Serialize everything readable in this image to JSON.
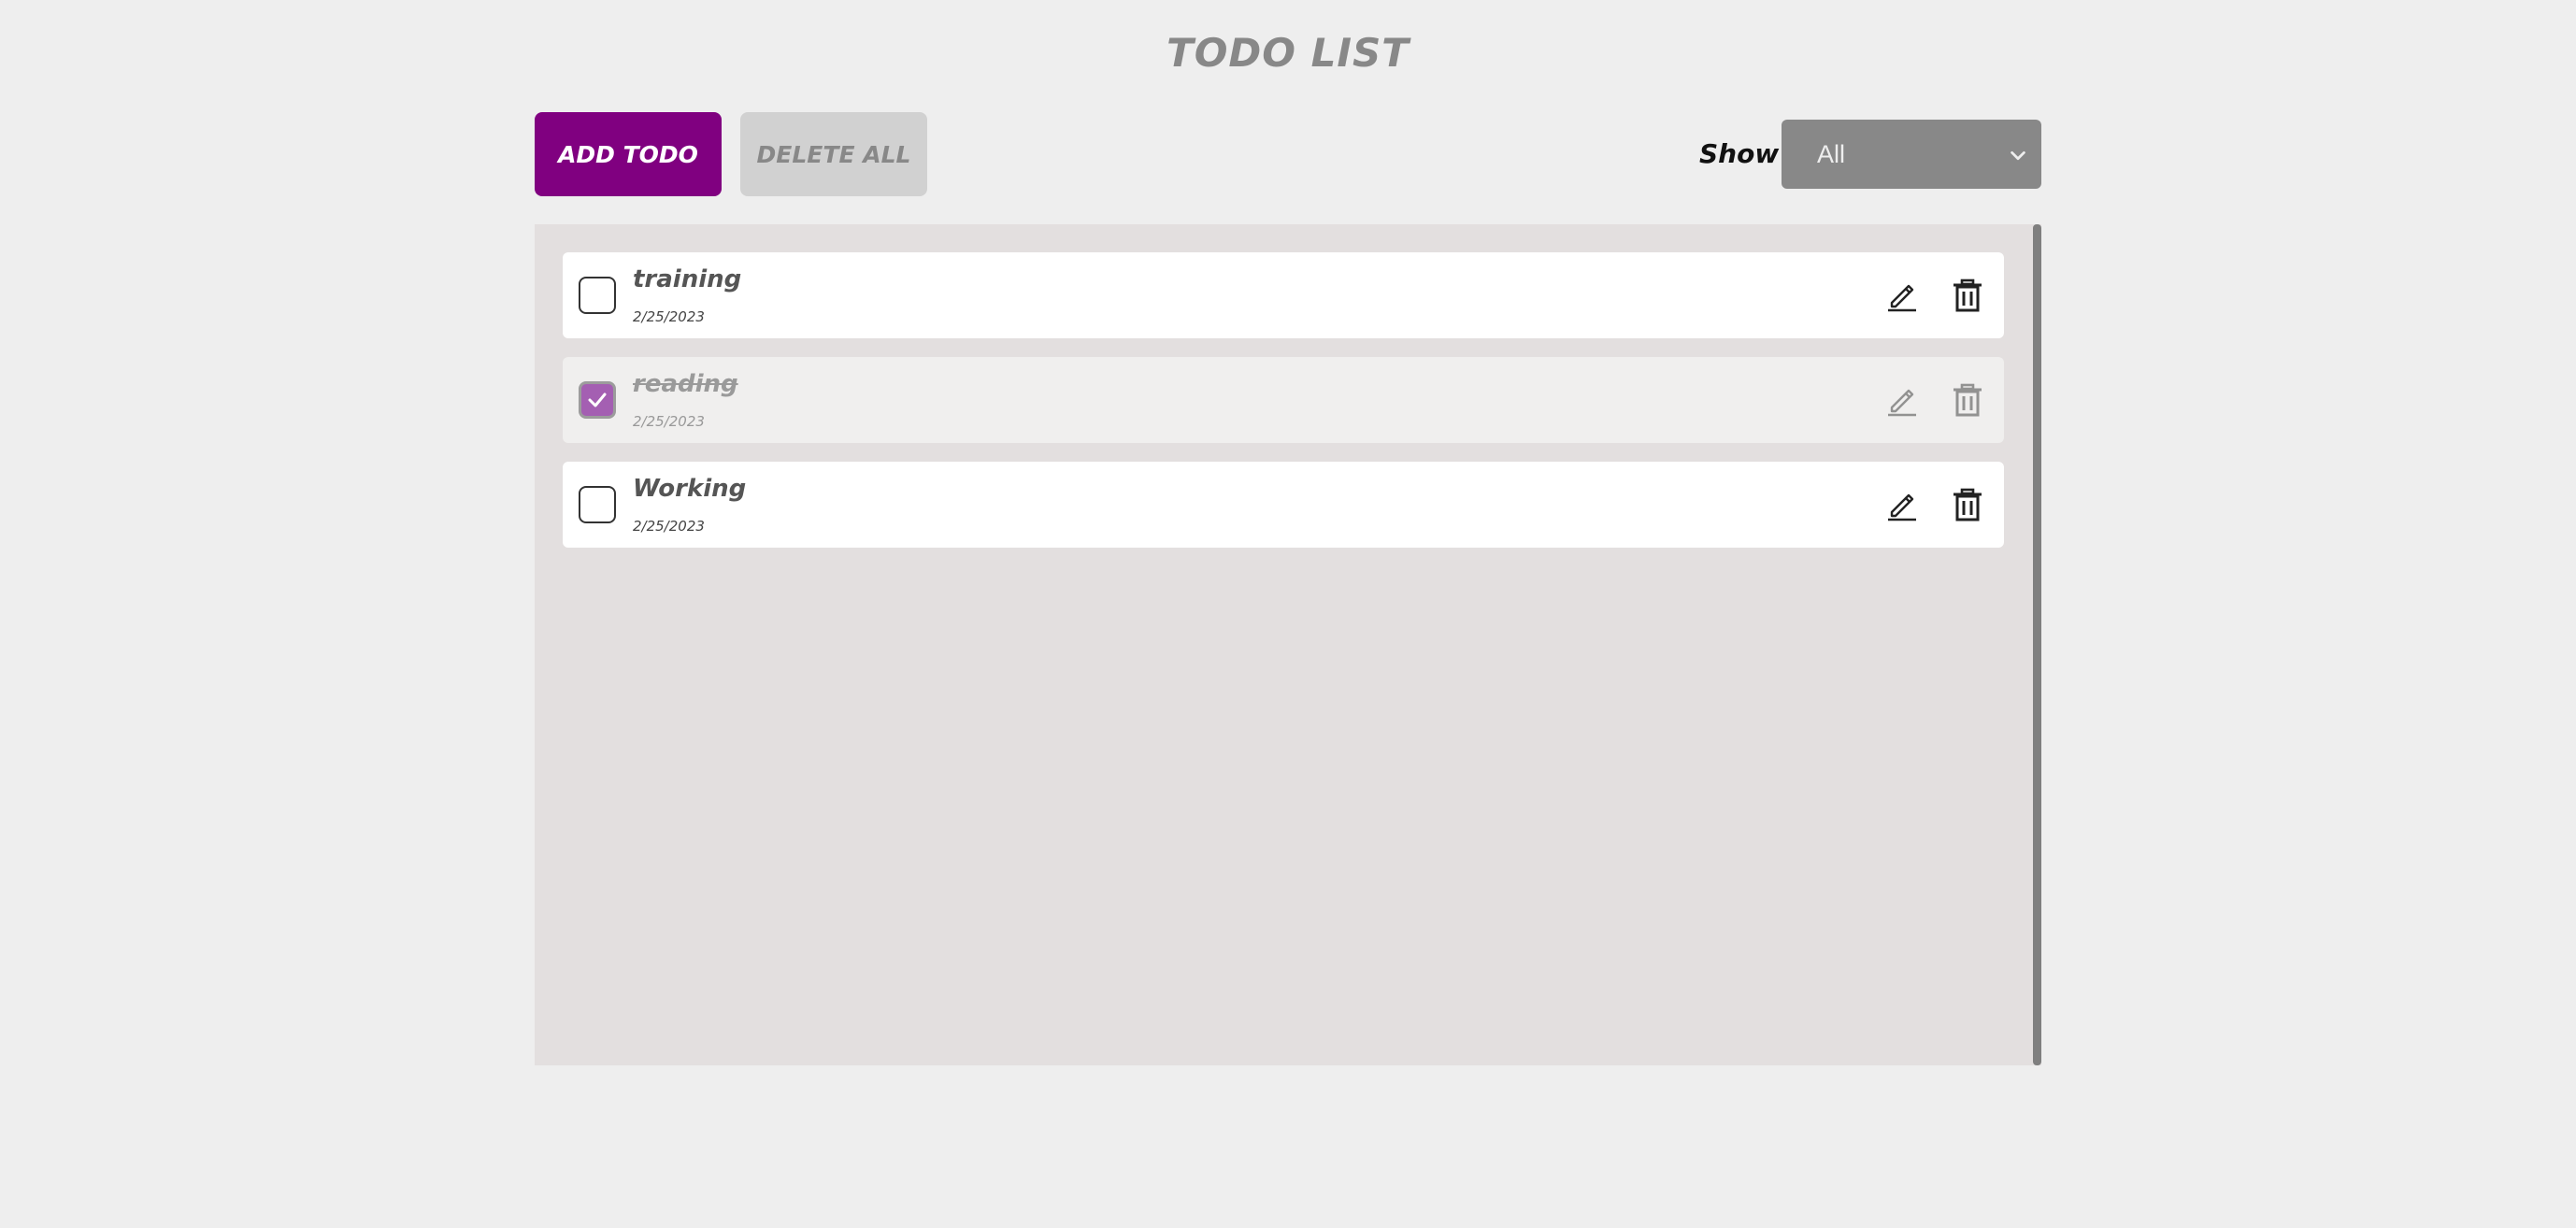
{
  "header": {
    "title": "TODO LIST"
  },
  "toolbar": {
    "add_label": "ADD TODO",
    "delete_all_label": "DELETE ALL",
    "show_label": "Show",
    "filter_selected": "All"
  },
  "todos": [
    {
      "title": "training",
      "date": "2/25/2023",
      "completed": false
    },
    {
      "title": "reading",
      "date": "2/25/2023",
      "completed": true
    },
    {
      "title": "Working",
      "date": "2/25/2023",
      "completed": false
    }
  ],
  "colors": {
    "accent": "#800080",
    "checkbox_checked": "#a45fb2",
    "background": "#eeeeee",
    "panel": "#e3dfdf"
  },
  "icons": {
    "edit": "pencil-icon",
    "delete": "trash-icon",
    "checkmark": "check-icon",
    "dropdown": "chevron-down-icon"
  }
}
